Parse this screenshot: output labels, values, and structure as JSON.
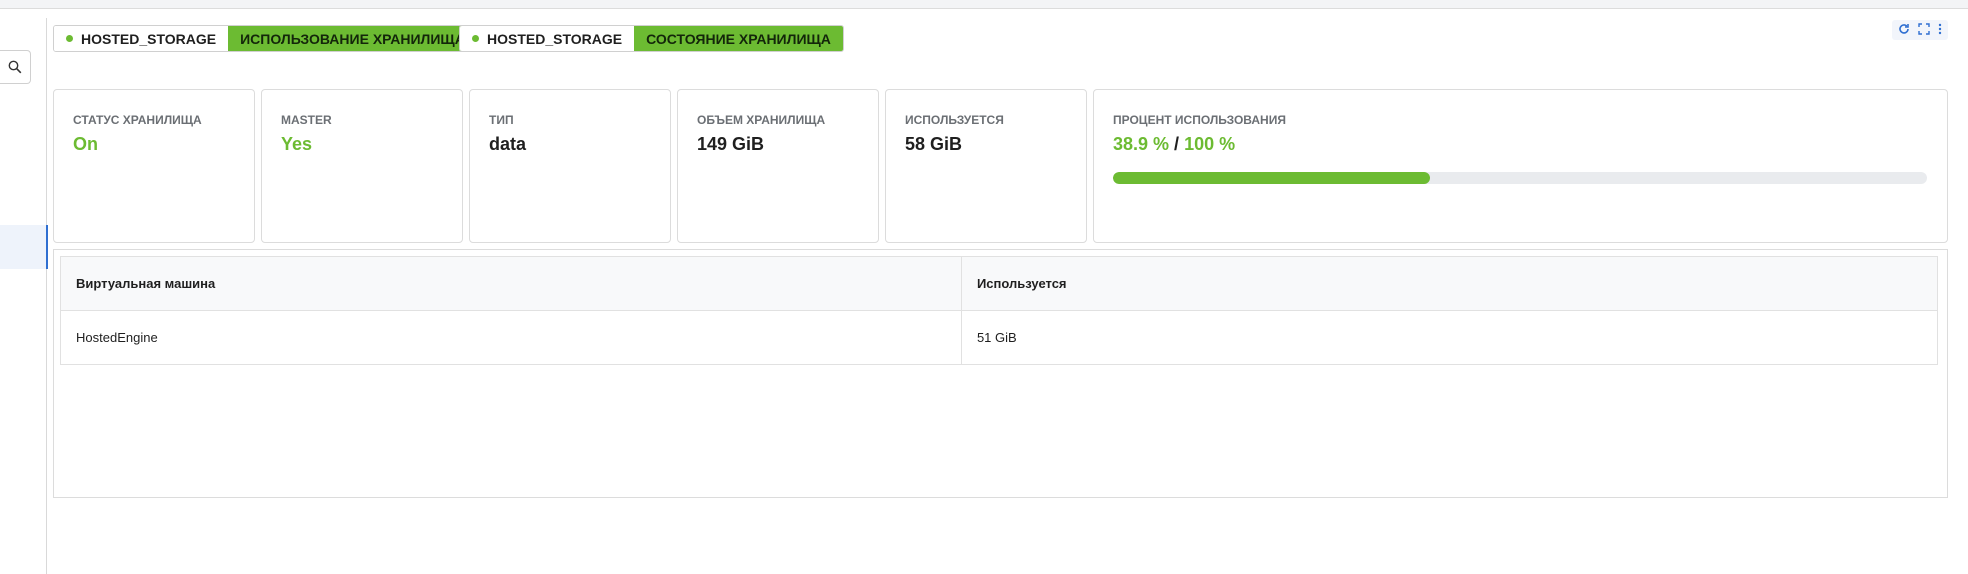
{
  "tags": [
    {
      "type": "HOSTED_STORAGE",
      "label": "ИСПОЛЬЗОВАНИЕ ХРАНИЛИЩА"
    },
    {
      "type": "HOSTED_STORAGE",
      "label": "СОСТОЯНИЕ ХРАНИЛИЩА"
    }
  ],
  "cards": {
    "status": {
      "label": "СТАТУС ХРАНИЛИЩА",
      "value": "On"
    },
    "master": {
      "label": "MASTER",
      "value": "Yes"
    },
    "type": {
      "label": "ТИП",
      "value": "data"
    },
    "volume": {
      "label": "ОБЪЕМ ХРАНИЛИЩА",
      "value": "149 GiB"
    },
    "used": {
      "label": "ИСПОЛЬЗУЕТСЯ",
      "value": "58 GiB"
    },
    "percent": {
      "label": "ПРОЦЕНТ ИСПОЛЬЗОВАНИЯ",
      "value": "38.9 %",
      "sep": " / ",
      "total": "100 %",
      "fraction": 0.389
    }
  },
  "table": {
    "headers": [
      "Виртуальная машина",
      "Используется"
    ],
    "rows": [
      [
        "HostedEngine",
        "51 GiB"
      ]
    ]
  },
  "colors": {
    "accent": "#6cbb32",
    "link": "#2f6fd1"
  },
  "icons": {
    "search": "search-icon",
    "refresh": "refresh-icon",
    "expand": "expand-icon",
    "more": "more-icon"
  }
}
